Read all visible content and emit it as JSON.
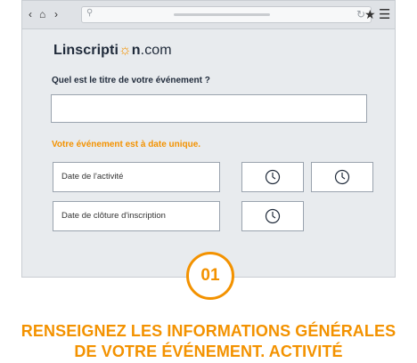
{
  "browser": {
    "url_value": "",
    "icons": [
      "chevron-left-icon",
      "home-icon",
      "chevron-right-icon",
      "search-icon",
      "reload-icon",
      "star-icon",
      "menu-icon"
    ]
  },
  "app": {
    "logo_part1": "Linscripti",
    "logo_part2": "n",
    "logo_part3": ".com"
  },
  "form": {
    "title_question": "Quel est le titre de votre événement ?",
    "title_value": "",
    "single_date_label": "Votre événement est à date unique.",
    "activity_date_label": "Date de l'activité",
    "registration_close_label": "Date de clôture d'inscription"
  },
  "step": {
    "number": "01",
    "headline_line1": "RENSEIGNEZ LES INFORMATIONS GÉNÉRALES",
    "headline_line2": "DE VOTRE ÉVÉNEMENT. ACTIVITÉ"
  },
  "colors": {
    "accent": "#f39200",
    "text_dark": "#1f2a3a",
    "window_bg": "#e8ebee"
  }
}
